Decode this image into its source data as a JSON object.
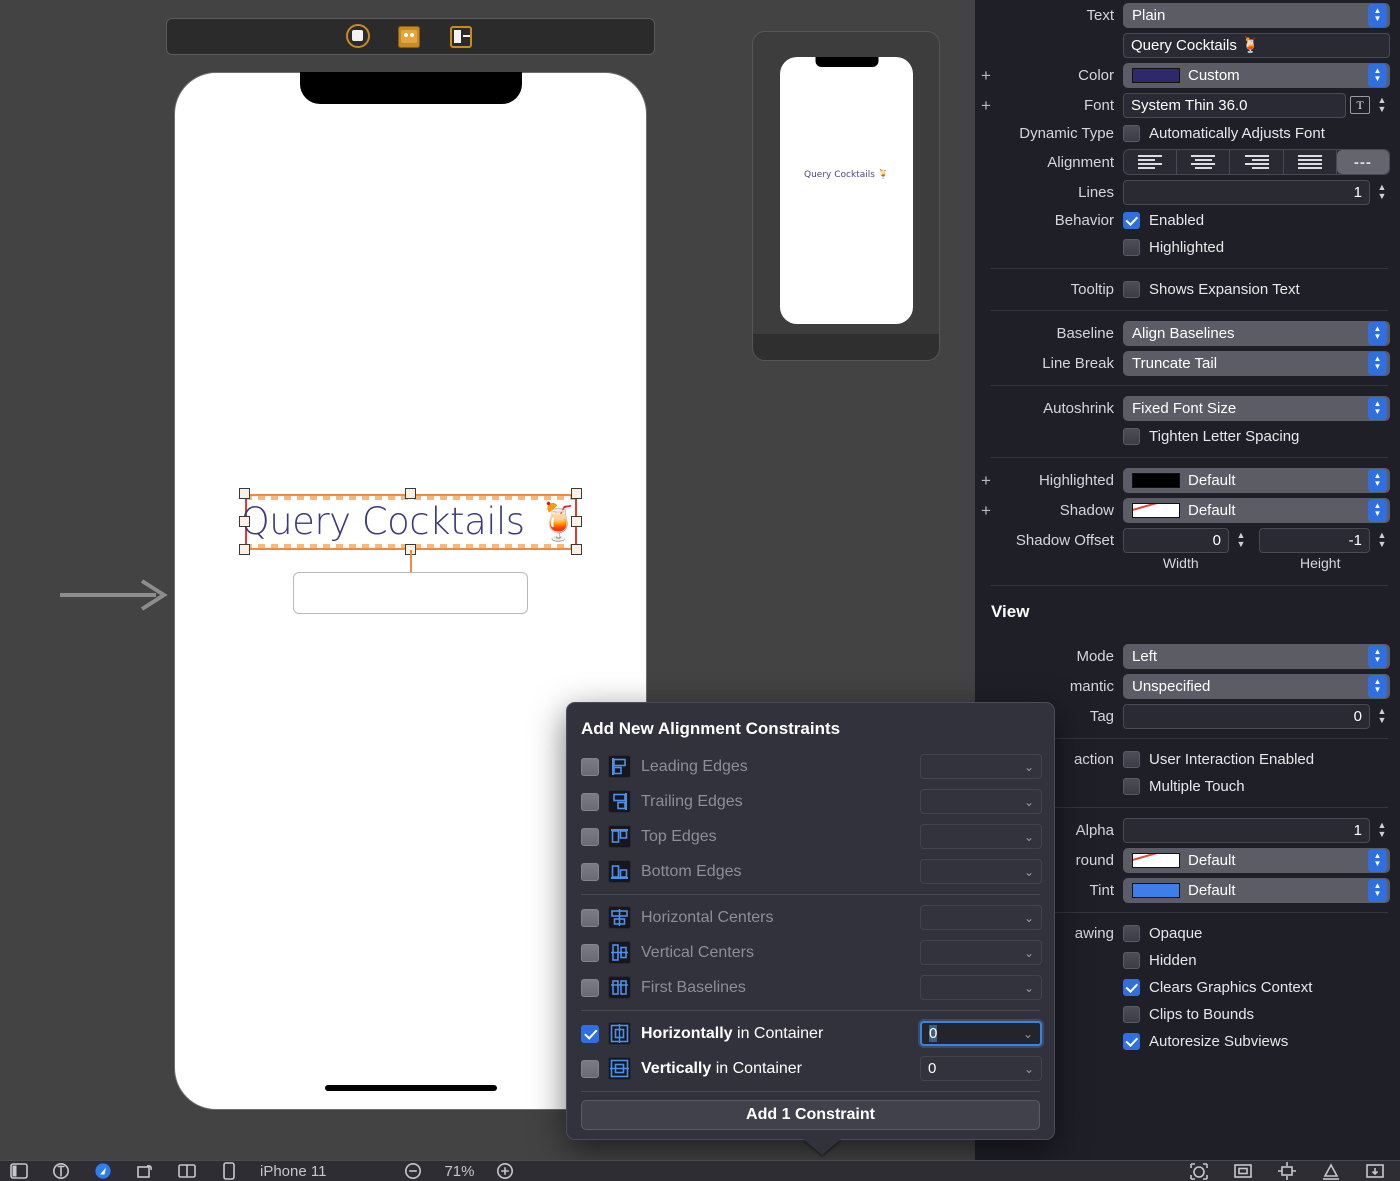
{
  "canvas": {
    "scene_dock": {
      "items": [
        {
          "name": "view-controller-icon",
          "label": "View Controller"
        },
        {
          "name": "first-responder-icon",
          "label": "First Responder"
        },
        {
          "name": "exit-icon",
          "label": "Exit"
        }
      ]
    },
    "selected_label_text": "Query Cocktails 🍹",
    "preview_label_text": "Query Cocktails 🍹"
  },
  "inspector": {
    "text_label": "Text",
    "text_style": "Plain",
    "text_value": "Query Cocktails 🍹",
    "color_label": "Color",
    "color_value": "Custom",
    "color_swatch_hex": "#2c2a6b",
    "font_label": "Font",
    "font_value": "System Thin 36.0",
    "dynamic_type_label": "Dynamic Type",
    "dynamic_type_checkbox": "Automatically Adjusts Font",
    "alignment_label": "Alignment",
    "alignment_options": [
      "left",
      "center",
      "right",
      "justified",
      "natural"
    ],
    "alignment_selected": "natural",
    "alignment_natural_glyph": "---",
    "lines_label": "Lines",
    "lines_value": "1",
    "behavior_label": "Behavior",
    "behavior_enabled": "Enabled",
    "behavior_highlighted": "Highlighted",
    "tooltip_label": "Tooltip",
    "tooltip_checkbox": "Shows Expansion Text",
    "baseline_label": "Baseline",
    "baseline_value": "Align Baselines",
    "line_break_label": "Line Break",
    "line_break_value": "Truncate Tail",
    "autoshrink_label": "Autoshrink",
    "autoshrink_value": "Fixed Font Size",
    "tighten_checkbox": "Tighten Letter Spacing",
    "highlighted_label": "Highlighted",
    "highlighted_value": "Default",
    "highlighted_swatch_hex": "#000000",
    "shadow_label": "Shadow",
    "shadow_value": "Default",
    "shadow_offset_label": "Shadow Offset",
    "shadow_offset_width": "0",
    "shadow_offset_height": "-1",
    "width_sublabel": "Width",
    "height_sublabel": "Height",
    "view_section_title": "View",
    "mode_label": "Mode",
    "mode_value": "Left",
    "semantic_label": "mantic",
    "semantic_value": "Unspecified",
    "tag_label": "Tag",
    "tag_value": "0",
    "interaction_label": "action",
    "user_interaction_checkbox": "User Interaction Enabled",
    "multiple_touch_checkbox": "Multiple Touch",
    "alpha_label": "Alpha",
    "alpha_value": "1",
    "background_label": "round",
    "background_value": "Default",
    "tint_label": "Tint",
    "tint_value": "Default",
    "tint_swatch_hex": "#3d7ee8",
    "drawing_label": "awing",
    "opaque_checkbox": "Opaque",
    "hidden_checkbox": "Hidden",
    "clears_graphics_checkbox": "Clears Graphics Context",
    "clips_to_bounds_checkbox": "Clips to Bounds",
    "autoresize_subviews_checkbox": "Autoresize Subviews"
  },
  "popover": {
    "title": "Add New Alignment Constraints",
    "rows": [
      {
        "label": "Leading Edges",
        "checked": false,
        "enabled": false,
        "value": "",
        "icon": "align-leading-edges-icon"
      },
      {
        "label": "Trailing Edges",
        "checked": false,
        "enabled": false,
        "value": "",
        "icon": "align-trailing-edges-icon"
      },
      {
        "label": "Top Edges",
        "checked": false,
        "enabled": false,
        "value": "",
        "icon": "align-top-edges-icon"
      },
      {
        "label": "Bottom Edges",
        "checked": false,
        "enabled": false,
        "value": "",
        "icon": "align-bottom-edges-icon"
      },
      {
        "label": "Horizontal Centers",
        "checked": false,
        "enabled": false,
        "value": "",
        "icon": "align-horizontal-centers-icon"
      },
      {
        "label": "Vertical Centers",
        "checked": false,
        "enabled": false,
        "value": "",
        "icon": "align-vertical-centers-icon"
      },
      {
        "label": "First Baselines",
        "checked": false,
        "enabled": false,
        "value": "",
        "icon": "align-first-baselines-icon"
      }
    ],
    "container_rows": [
      {
        "bold": "Horizontally",
        "rest": " in Container",
        "checked": true,
        "value": "0",
        "icon": "center-horizontally-in-container-icon"
      },
      {
        "bold": "Vertically",
        "rest": " in Container",
        "checked": false,
        "value": "0",
        "icon": "center-vertically-in-container-icon"
      }
    ],
    "button_label": "Add 1 Constraint"
  },
  "bottombar": {
    "device_name": "iPhone 11",
    "zoom_value": "71%",
    "zoom_out_label": "−",
    "zoom_in_label": "+",
    "left_icons": [
      "document-outline-icon",
      "add-constraint-icon",
      "assistant-icon",
      "rotate-icon",
      "split-view-icon",
      "device-icon"
    ],
    "right_icons": [
      "update-frames-icon",
      "align-icon",
      "pin-icon",
      "resolve-issues-icon",
      "embed-in-icon"
    ]
  }
}
